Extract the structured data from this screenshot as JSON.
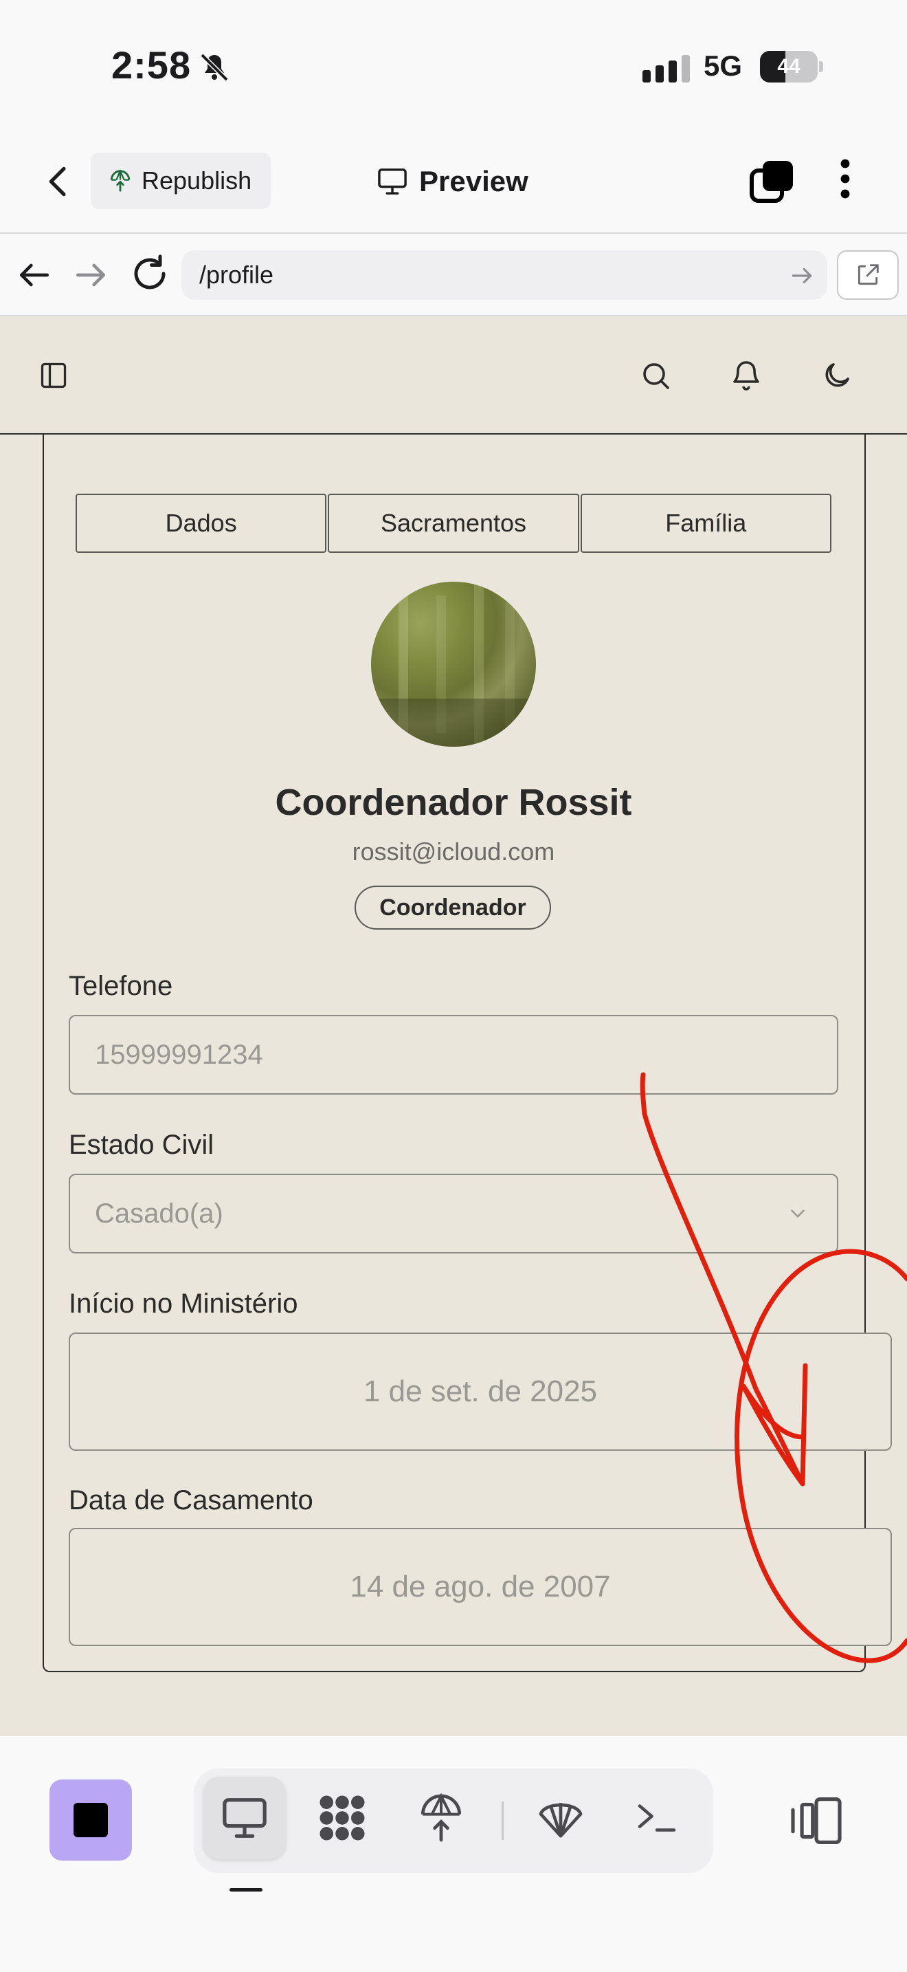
{
  "status_bar": {
    "time": "2:58",
    "network": "5G",
    "battery": "44",
    "battery_level": 0.44
  },
  "app_bar": {
    "republish_label": "Republish",
    "preview_label": "Preview"
  },
  "browser": {
    "url": "/profile"
  },
  "profile": {
    "tabs": [
      {
        "label": "Dados"
      },
      {
        "label": "Sacramentos"
      },
      {
        "label": "Família"
      }
    ],
    "name": "Coordenador Rossit",
    "email": "rossit@icloud.com",
    "role": "Coordenador",
    "fields": {
      "phone_label": "Telefone",
      "phone_value": "15999991234",
      "civil_label": "Estado Civil",
      "civil_value": "Casado(a)",
      "ministry_label": "Início no Ministério",
      "ministry_value": "1 de set. de 2025",
      "wedding_label": "Data de Casamento",
      "wedding_value": "14 de ago. de 2007"
    }
  },
  "colors": {
    "site_background": "#ebe6dc",
    "annotation": "#e0200c",
    "stop_button": "#b9a6f5"
  },
  "icons": [
    "back-icon",
    "republish-icon",
    "desktop-icon",
    "tabs-icon",
    "more-icon",
    "arrow-left-icon",
    "arrow-right-icon",
    "reload-icon",
    "open-external-icon",
    "sidebar-icon",
    "search-icon",
    "bell-icon",
    "moon-icon",
    "chevron-down-icon",
    "stop-icon",
    "grid-icon",
    "deploy-icon",
    "shell-icon",
    "terminal-icon",
    "devices-icon"
  ]
}
